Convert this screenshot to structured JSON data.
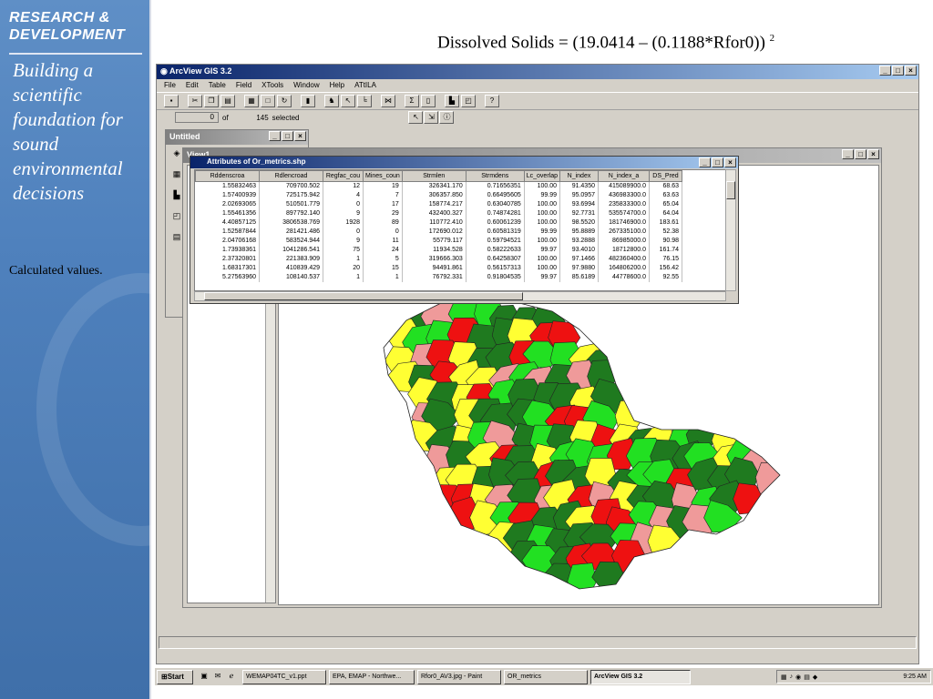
{
  "slide": {
    "formula": "Dissolved Solids = (19.0414 – (0.1188*Rfor0))",
    "formula_superscript": "2",
    "caption": "Calculated values."
  },
  "sidebar": {
    "heading_line1": "RESEARCH &",
    "heading_line2": "DEVELOPMENT",
    "tagline": "Building a scientific foundation for sound environmental decisions"
  },
  "arcview": {
    "title": "ArcView GIS 3.2",
    "menu": [
      "File",
      "Edit",
      "Table",
      "Field",
      "XTools",
      "Window",
      "Help",
      "ATtILA"
    ],
    "selection": {
      "count": "0",
      "of_label": "of",
      "selected": "145",
      "selected_label": "selected"
    }
  },
  "untitled_window": {
    "title": "Untitled"
  },
  "view_window": {
    "title": "View1"
  },
  "attribute_table": {
    "title": "Attributes of Or_metrics.shp",
    "columns": [
      "Rddenscroa",
      "Rdlencroad",
      "Regfac_cou",
      "Mines_coun",
      "Strmlen",
      "Strmdens",
      "Lc_overlap",
      "N_index",
      "N_index_a",
      "DS_Pred"
    ],
    "rows": [
      [
        "1.55832463",
        "709700.502",
        "12",
        "19",
        "326341.170",
        "0.71656351",
        "100.00",
        "91.4350",
        "415089900.0",
        "68.63"
      ],
      [
        "1.57400939",
        "725175.942",
        "4",
        "7",
        "306357.850",
        "0.66495605",
        "99.99",
        "95.0957",
        "436983300.0",
        "63.63"
      ],
      [
        "2.02693065",
        "510501.779",
        "0",
        "17",
        "158774.217",
        "0.63040785",
        "100.00",
        "93.6994",
        "235833300.0",
        "65.04"
      ],
      [
        "1.55461356",
        "897792.140",
        "9",
        "29",
        "432400.327",
        "0.74874281",
        "100.00",
        "92.7731",
        "535574700.0",
        "64.04"
      ],
      [
        "4.40857125",
        "3806538.769",
        "1928",
        "89",
        "110772.410",
        "0.60061239",
        "100.00",
        "98.5520",
        "181746900.0",
        "183.61"
      ],
      [
        "1.52587844",
        "281421.486",
        "0",
        "0",
        "172690.012",
        "0.60581319",
        "99.99",
        "95.8889",
        "267335100.0",
        "52.38"
      ],
      [
        "2.04706168",
        "583524.944",
        "9",
        "11",
        "55779.117",
        "0.59794521",
        "100.00",
        "93.2888",
        "86985000.0",
        "90.98"
      ],
      [
        "1.73938361",
        "1041286.541",
        "75",
        "24",
        "11934.528",
        "0.58222633",
        "99.97",
        "93.4010",
        "18712800.0",
        "161.74"
      ],
      [
        "2.37320801",
        "221383.909",
        "1",
        "5",
        "319666.303",
        "0.64258307",
        "100.00",
        "97.1466",
        "482360400.0",
        "76.15"
      ],
      [
        "1.68317301",
        "410839.429",
        "20",
        "15",
        "94491.861",
        "0.56157313",
        "100.00",
        "97.9880",
        "164806200.0",
        "156.42"
      ],
      [
        "5.27563960",
        "108140.537",
        "1",
        "1",
        "76792.331",
        "0.91804535",
        "99.97",
        "85.6189",
        "44778600.0",
        "92.55"
      ]
    ]
  },
  "map": {
    "colors": {
      "dark_green": "#1f7a1f",
      "green": "#22e022",
      "yellow": "#ffff33",
      "red": "#ee1111",
      "pink": "#ef9a9a"
    }
  },
  "taskbar": {
    "start_label": "Start",
    "tasks": [
      "WEMAP04TC_v1.ppt",
      "EPA, EMAP - Northwe...",
      "Rfor0_AV3.jpg - Paint",
      "OR_metrics",
      "ArcView GIS 3.2"
    ],
    "clock": "9:25 AM"
  }
}
